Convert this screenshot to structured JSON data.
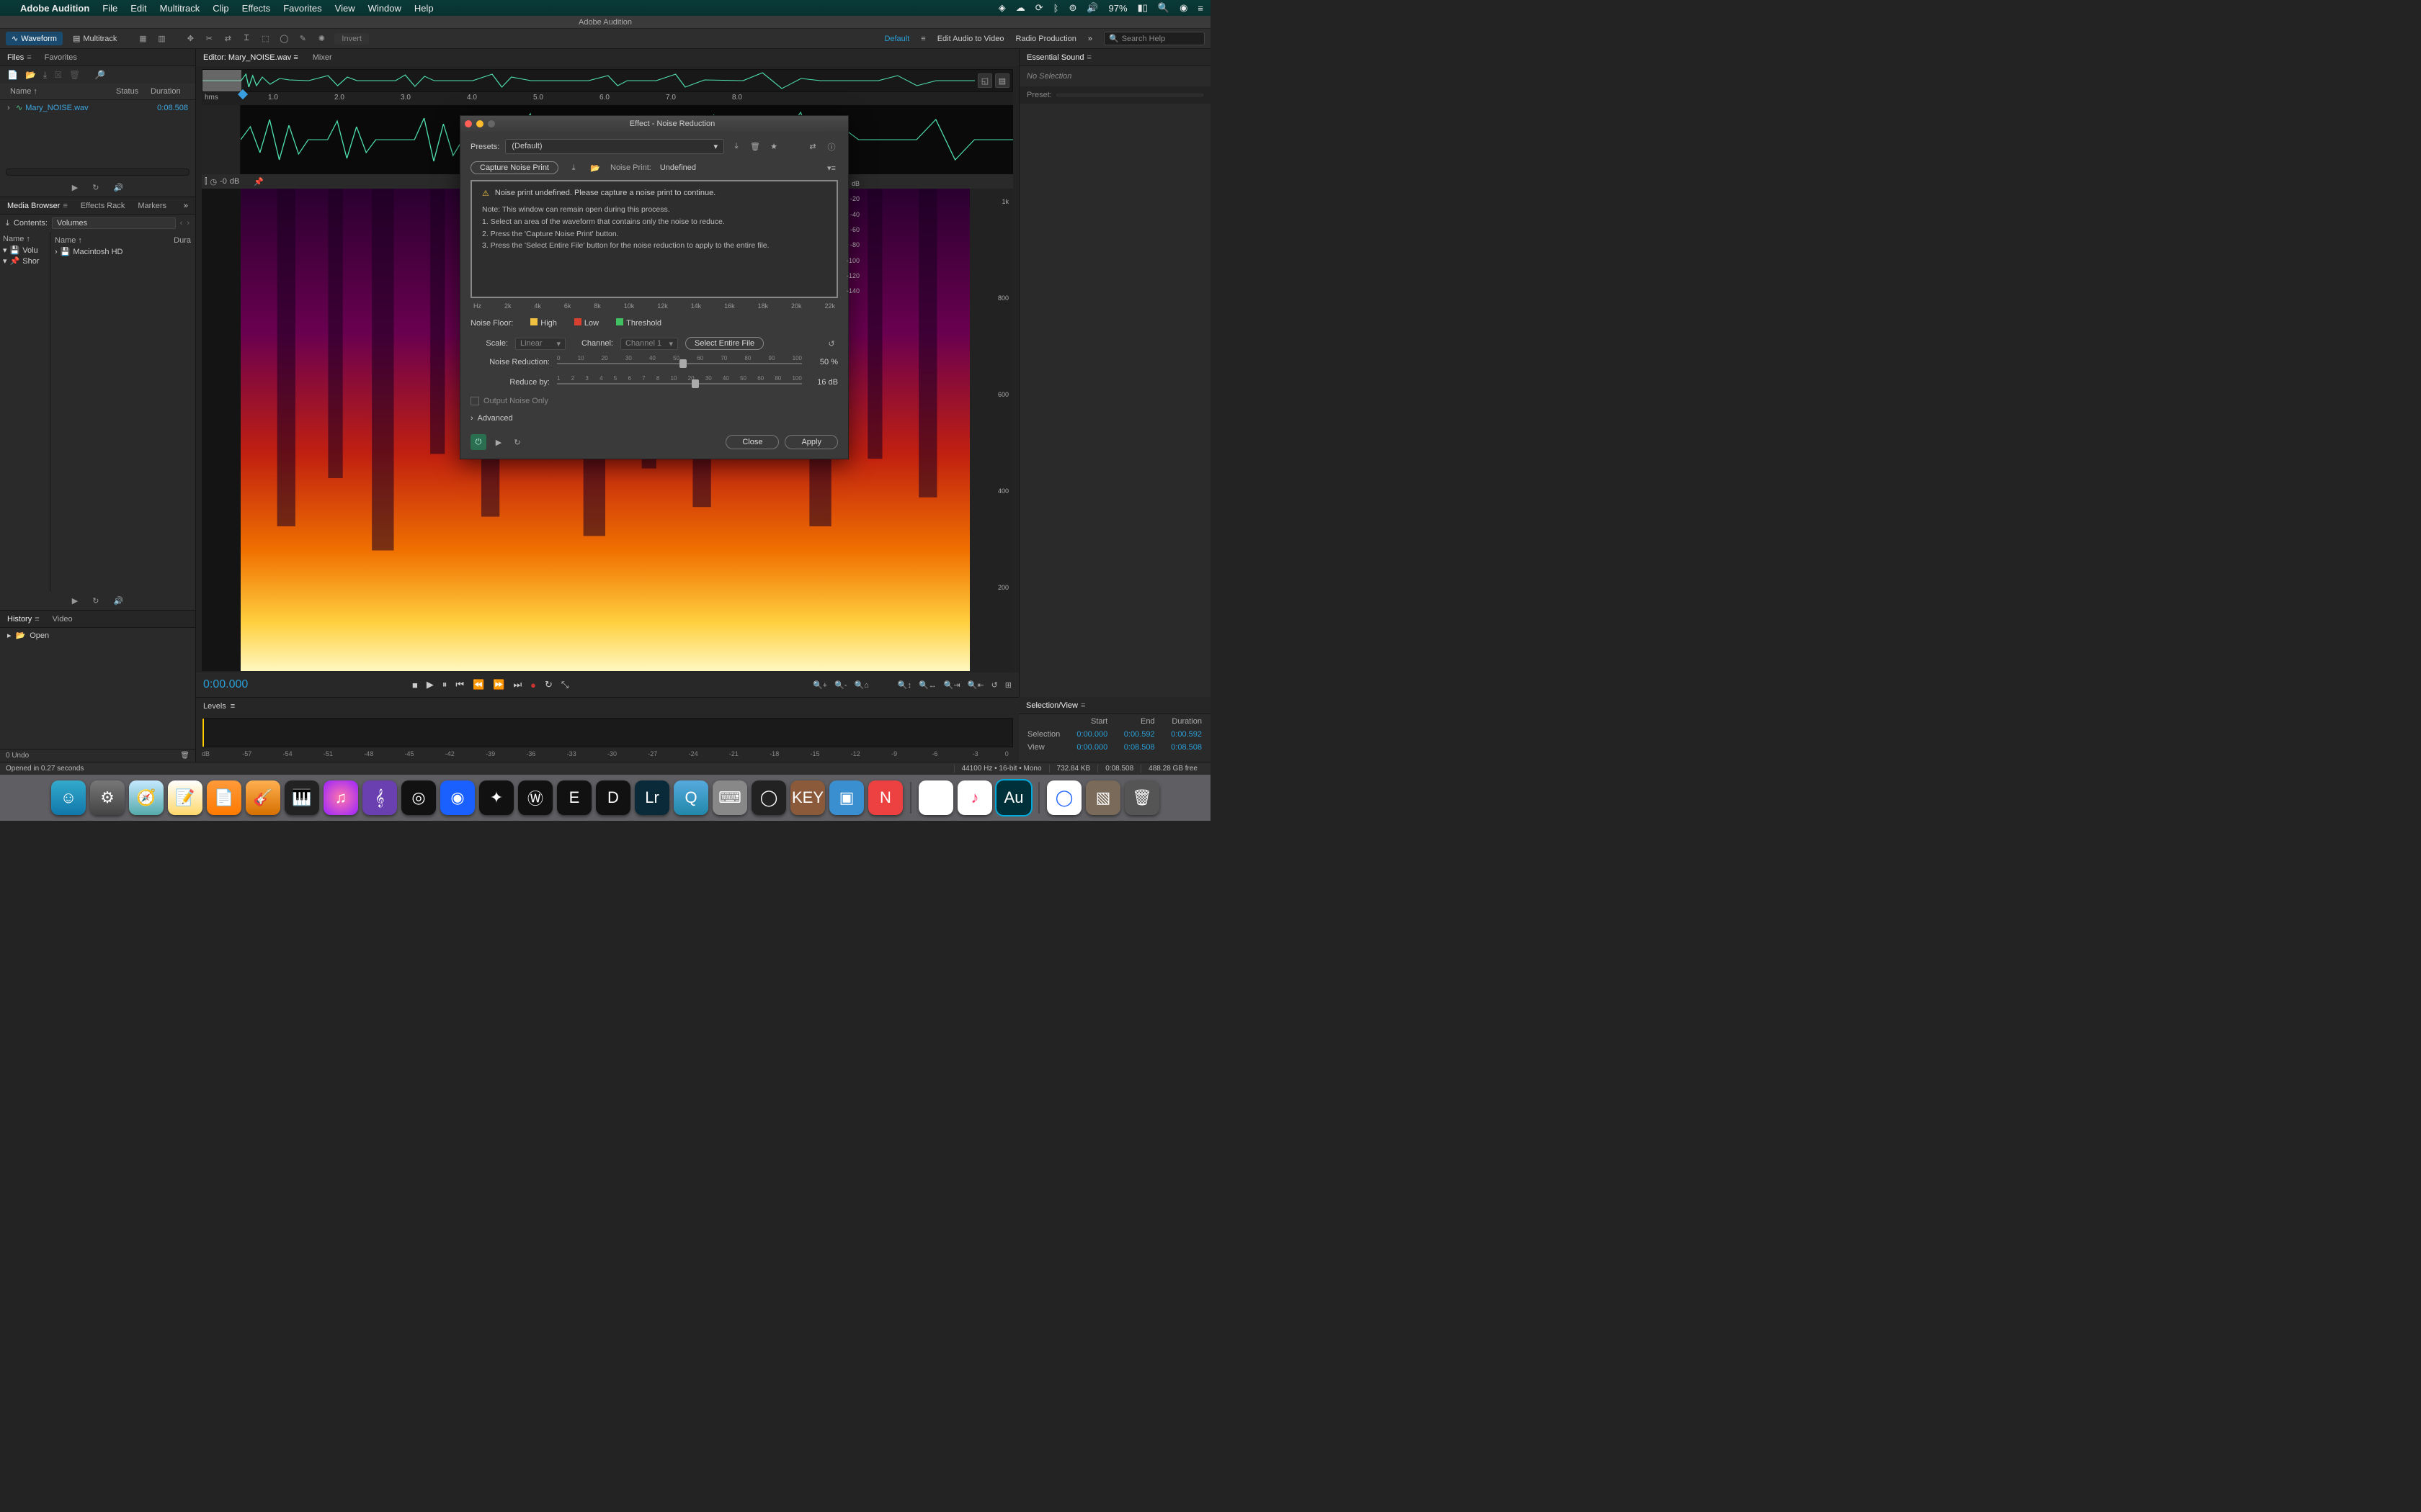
{
  "menubar": {
    "app": "Adobe Audition",
    "items": [
      "File",
      "Edit",
      "Multitrack",
      "Clip",
      "Effects",
      "Favorites",
      "View",
      "Window",
      "Help"
    ],
    "battery": "97%"
  },
  "window_title": "Adobe Audition",
  "toolbar": {
    "waveform": "Waveform",
    "multitrack": "Multitrack",
    "invert": "Invert",
    "workspaces": {
      "default": "Default",
      "edit_av": "Edit Audio to Video",
      "radio": "Radio Production"
    },
    "search_placeholder": "Search Help"
  },
  "files_panel": {
    "tab_files": "Files",
    "tab_favorites": "Favorites",
    "cols": {
      "name": "Name ↑",
      "status": "Status",
      "duration": "Duration"
    },
    "rows": [
      {
        "name": "Mary_NOISE.wav",
        "duration": "0:08.508"
      }
    ]
  },
  "media_browser": {
    "tabs": {
      "browser": "Media Browser",
      "fx": "Effects Rack",
      "markers": "Markers"
    },
    "contents_label": "Contents:",
    "contents_value": "Volumes",
    "left_hdr": "Name ↑",
    "right_hdr_name": "Name ↑",
    "right_hdr_dur": "Dura",
    "left_items": [
      "Volu",
      "Shor"
    ],
    "right_items": [
      "Macintosh HD"
    ]
  },
  "history": {
    "tab_history": "History",
    "tab_video": "Video",
    "item": "Open"
  },
  "editor": {
    "tab_label": "Editor: Mary_NOISE.wav",
    "tab_mixer": "Mixer",
    "ruler_label": "hms",
    "ticks": [
      "1.0",
      "2.0",
      "3.0",
      "4.0",
      "5.0",
      "6.0",
      "7.0",
      "8.0"
    ],
    "wave_ruler": "dB",
    "wave_db_val": "-0",
    "spectro_freqs": [
      "1k",
      "800",
      "600",
      "400",
      "200"
    ]
  },
  "transport": {
    "time": "0:00.000"
  },
  "levels": {
    "tab": "Levels",
    "ticks": [
      "dB",
      "-57",
      "-54",
      "-51",
      "-48",
      "-45",
      "-42",
      "-39",
      "-36",
      "-33",
      "-30",
      "-27",
      "-24",
      "-21",
      "-18",
      "-15",
      "-12",
      "-9",
      "-6",
      "-3",
      "0"
    ]
  },
  "essential_sound": {
    "title": "Essential Sound",
    "no_selection": "No Selection",
    "preset_label": "Preset:"
  },
  "selection_view": {
    "title": "Selection/View",
    "hdr": {
      "start": "Start",
      "end": "End",
      "duration": "Duration"
    },
    "selection": {
      "label": "Selection",
      "start": "0:00.000",
      "end": "0:00.592",
      "duration": "0:00.592"
    },
    "view": {
      "label": "View",
      "start": "0:00.000",
      "end": "0:08.508",
      "duration": "0:08.508"
    }
  },
  "undo_bar": "0 Undo",
  "status": {
    "opened": "Opened in 0.27 seconds",
    "format": "44100 Hz • 16-bit • Mono",
    "size": "732.84 KB",
    "dur": "0:08.508",
    "free": "488.28 GB free"
  },
  "modal": {
    "title": "Effect - Noise Reduction",
    "presets_label": "Presets:",
    "presets_value": "(Default)",
    "capture_btn": "Capture Noise Print",
    "noise_print_label": "Noise Print:",
    "noise_print_value": "Undefined",
    "warning": "Noise print undefined. Please capture a noise print to continue.",
    "note": "Note: This window can remain open during this process.",
    "step1": "1. Select an area of the waveform that contains only the noise to reduce.",
    "step2": "2. Press the 'Capture Noise Print' button.",
    "step3": "3. Press the 'Select Entire File' button for the noise reduction to apply to the entire file.",
    "db_ticks": [
      "dB",
      "-20",
      "-40",
      "-60",
      "-80",
      "-100",
      "-120",
      "-140"
    ],
    "hz_ticks": [
      "Hz",
      "2k",
      "4k",
      "6k",
      "8k",
      "10k",
      "12k",
      "14k",
      "16k",
      "18k",
      "20k",
      "22k"
    ],
    "noise_floor_label": "Noise Floor:",
    "legend": {
      "high": "High",
      "low": "Low",
      "threshold": "Threshold"
    },
    "scale_label": "Scale:",
    "scale_value": "Linear",
    "channel_label": "Channel:",
    "channel_value": "Channel 1",
    "select_entire": "Select Entire File",
    "nr_label": "Noise Reduction:",
    "nr_ticks": [
      "0",
      "10",
      "20",
      "30",
      "40",
      "50",
      "60",
      "70",
      "80",
      "90",
      "100"
    ],
    "nr_value": "50",
    "nr_unit": "%",
    "rb_label": "Reduce by:",
    "rb_ticks": [
      "1",
      "2",
      "3",
      "4",
      "5",
      "6",
      "7",
      "8",
      "10",
      "20",
      "30",
      "40",
      "50",
      "60",
      "80",
      "100"
    ],
    "rb_value": "16",
    "rb_unit": "dB",
    "output_noise": "Output Noise Only",
    "advanced": "Advanced",
    "close": "Close",
    "apply": "Apply"
  }
}
